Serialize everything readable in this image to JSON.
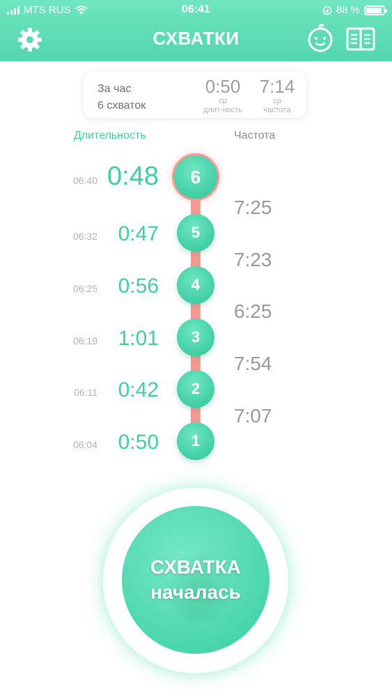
{
  "status_bar": {
    "carrier": "MTS RUS",
    "time": "06:41",
    "battery": "88 %"
  },
  "header": {
    "title": "СХВАТКИ"
  },
  "icons": {
    "settings": "gear-icon",
    "baby": "baby-face-icon",
    "book": "book-icon"
  },
  "summary": {
    "line1": "За час",
    "line2": "6 схваток",
    "avg_duration": {
      "value": "0:50",
      "label1": "ср",
      "label2": "длит-ность"
    },
    "avg_frequency": {
      "value": "7:14",
      "label1": "ср",
      "label2": "частота"
    }
  },
  "columns": {
    "duration": "Длительность",
    "frequency": "Частота"
  },
  "contractions": [
    {
      "num": "6",
      "time": "06:40",
      "duration": "0:48"
    },
    {
      "num": "5",
      "time": "06:32",
      "duration": "0:47"
    },
    {
      "num": "4",
      "time": "06:25",
      "duration": "0:56"
    },
    {
      "num": "3",
      "time": "06:19",
      "duration": "1:01"
    },
    {
      "num": "2",
      "time": "06:11",
      "duration": "0:42"
    },
    {
      "num": "1",
      "time": "06:04",
      "duration": "0:50"
    }
  ],
  "frequencies": [
    "7:25",
    "7:23",
    "6:25",
    "7:54",
    "7:07"
  ],
  "action_button": {
    "line1": "СХВАТКА",
    "line2": "началась"
  },
  "colors": {
    "accent": "#3fcea2",
    "header": "#5ad9b4",
    "connector": "#f39b93"
  }
}
